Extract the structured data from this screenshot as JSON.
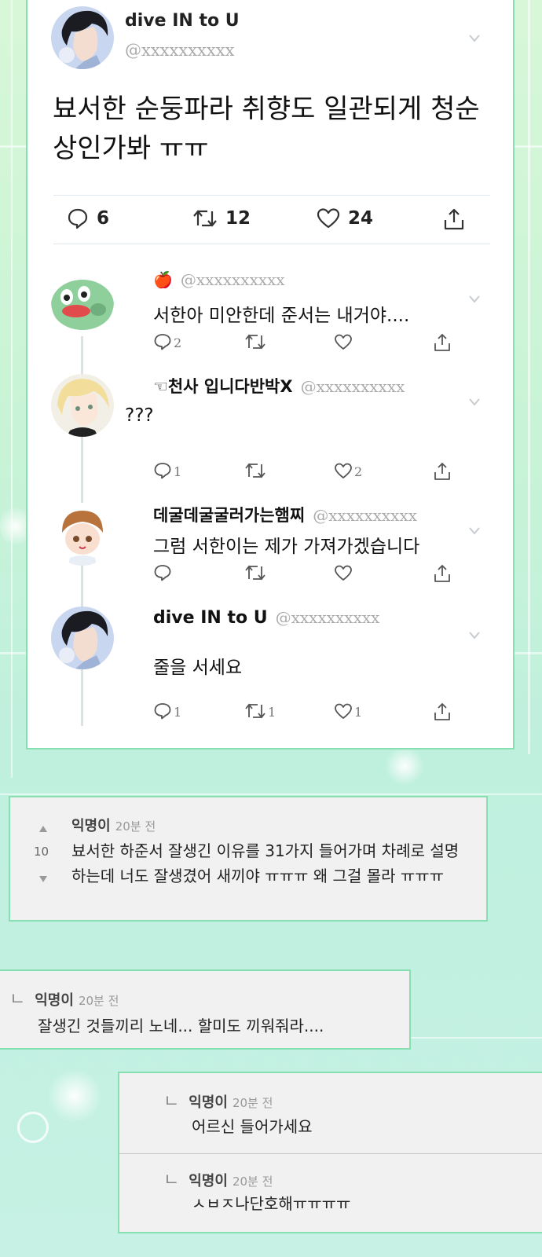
{
  "tweet": {
    "author_name": "dive IN to U",
    "author_handle": "@xxxxxxxxxx",
    "text": "뵤서한 순둥파라 취향도 일관되게 청순상인가봐 ㅠㅠ",
    "stats": {
      "replies": "6",
      "retweets": "12",
      "likes": "24"
    }
  },
  "replies": [
    {
      "emoji": "🍎",
      "name": "",
      "handle": "@xxxxxxxxxx",
      "text": "서한아 미안한데 준서는 내거야....",
      "reply_count": "2",
      "retweet_count": "",
      "like_count": ""
    },
    {
      "emoji": "☜",
      "name": "천사 입니다반박X",
      "handle": "@xxxxxxxxxx",
      "text": "???",
      "reply_count": "1",
      "retweet_count": "",
      "like_count": "2"
    },
    {
      "emoji": "",
      "name": "데굴데굴굴러가는햄찌",
      "handle": "@xxxxxxxxxx",
      "text": "그럼 서한이는 제가 가져가겠습니다",
      "reply_count": "",
      "retweet_count": "",
      "like_count": ""
    },
    {
      "emoji": "",
      "name": "dive IN to U",
      "handle": "@xxxxxxxxxx",
      "text": "줄을 서세요",
      "reply_count": "1",
      "retweet_count": "1",
      "like_count": "1"
    }
  ],
  "comments": {
    "top": {
      "author": "익명이",
      "time": "20분 전",
      "votes": "10",
      "text": "뵤서한 하준서 잘생긴 이유를 31가지 들어가며 차례로 설명하는데 너도 잘생겼어 새끼야 ㅠㅠㅠ 왜 그걸 몰라 ㅠㅠㅠ"
    },
    "reply1": {
      "arrow": "ㄴ",
      "author": "익명이",
      "time": "20분 전",
      "text": "잘생긴 것들끼리 노네... 할미도 끼워줘라...."
    },
    "reply2": {
      "arrow": "ㄴ",
      "author": "익명이",
      "time": "20분 전",
      "text": "어르신 들어가세요"
    },
    "reply3": {
      "arrow": "ㄴ",
      "author": "익명이",
      "time": "20분 전",
      "text": "ㅅㅂㅈ나단호해ㅠㅠㅠㅠ"
    }
  },
  "colors": {
    "card_border": "#86dfb0",
    "background": "#c8f3d6",
    "comment_bg": "#f1f1f1"
  },
  "icons": [
    "reply-icon",
    "retweet-icon",
    "like-icon",
    "share-icon",
    "chevron-down-icon",
    "vote-up-icon",
    "vote-down-icon"
  ]
}
